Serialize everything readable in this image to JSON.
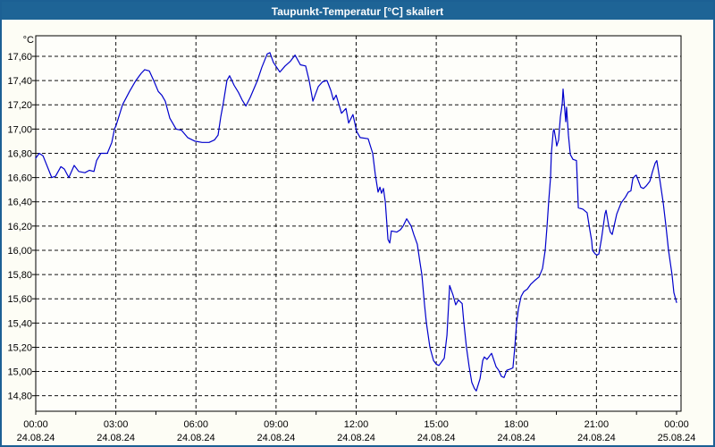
{
  "window": {
    "title": "Taupunkt-Temperatur [°C] skaliert"
  },
  "colors": {
    "titlebar_bg": "#1e6496",
    "window_border": "#1c6094",
    "window_bg": "#fdfdf5",
    "plot_bg": "#fefefa",
    "axis": "#000000",
    "grid": "#111111",
    "line": "#0000cc",
    "title_text": "#ffffff",
    "label_text": "#000000"
  },
  "chart_data": {
    "type": "line",
    "title": "Taupunkt-Temperatur [°C] skaliert",
    "unit_label": "°C",
    "xlabel": "",
    "ylabel": "°C",
    "grid": "dashed",
    "legend": "none",
    "x_range_hours": [
      0,
      24.17
    ],
    "y_range": [
      14.67,
      17.77
    ],
    "y_ticks": [
      {
        "value": 17.6,
        "label": "17,60"
      },
      {
        "value": 17.4,
        "label": "17,40"
      },
      {
        "value": 17.2,
        "label": "17,20"
      },
      {
        "value": 17.0,
        "label": "17,00"
      },
      {
        "value": 16.8,
        "label": "16,80"
      },
      {
        "value": 16.6,
        "label": "16,60"
      },
      {
        "value": 16.4,
        "label": "16,40"
      },
      {
        "value": 16.2,
        "label": "16,20"
      },
      {
        "value": 16.0,
        "label": "16,00"
      },
      {
        "value": 15.8,
        "label": "15,80"
      },
      {
        "value": 15.6,
        "label": "15,60"
      },
      {
        "value": 15.4,
        "label": "15,40"
      },
      {
        "value": 15.2,
        "label": "15,20"
      },
      {
        "value": 15.0,
        "label": "15,00"
      },
      {
        "value": 14.8,
        "label": "14,80"
      }
    ],
    "x_ticks": [
      {
        "hour": 0,
        "time": "00:00",
        "date": "24.08.24",
        "gridline": false
      },
      {
        "hour": 3,
        "time": "03:00",
        "date": "24.08.24",
        "gridline": true
      },
      {
        "hour": 6,
        "time": "06:00",
        "date": "24.08.24",
        "gridline": true
      },
      {
        "hour": 9,
        "time": "09:00",
        "date": "24.08.24",
        "gridline": true
      },
      {
        "hour": 12,
        "time": "12:00",
        "date": "24.08.24",
        "gridline": true
      },
      {
        "hour": 15,
        "time": "15:00",
        "date": "24.08.24",
        "gridline": true
      },
      {
        "hour": 18,
        "time": "18:00",
        "date": "24.08.24",
        "gridline": true
      },
      {
        "hour": 21,
        "time": "21:00",
        "date": "24.08.24",
        "gridline": true
      },
      {
        "hour": 24,
        "time": "00:00",
        "date": "25.08.24",
        "gridline": false
      }
    ],
    "x_minor_ticks_hours": [
      1.5,
      4.5,
      7.5,
      10.5,
      13.5,
      16.5,
      19.5,
      22.5
    ],
    "series": [
      {
        "name": "Taupunkt-Temperatur",
        "color": "#0000cc",
        "points": [
          [
            0,
            16.76
          ],
          [
            0.13,
            16.8
          ],
          [
            0.27,
            16.78
          ],
          [
            0.6,
            16.6
          ],
          [
            0.74,
            16.61
          ],
          [
            0.94,
            16.69
          ],
          [
            1.07,
            16.67
          ],
          [
            1.24,
            16.6
          ],
          [
            1.44,
            16.7
          ],
          [
            1.61,
            16.65
          ],
          [
            1.84,
            16.64
          ],
          [
            2.01,
            16.66
          ],
          [
            2.18,
            16.65
          ],
          [
            2.28,
            16.74
          ],
          [
            2.44,
            16.8
          ],
          [
            2.68,
            16.8
          ],
          [
            2.85,
            16.89
          ],
          [
            2.95,
            17.0
          ],
          [
            3.01,
            17.03
          ],
          [
            3.25,
            17.2
          ],
          [
            3.51,
            17.31
          ],
          [
            3.75,
            17.4
          ],
          [
            3.95,
            17.46
          ],
          [
            4.08,
            17.49
          ],
          [
            4.25,
            17.48
          ],
          [
            4.42,
            17.4
          ],
          [
            4.59,
            17.31
          ],
          [
            4.72,
            17.28
          ],
          [
            4.85,
            17.23
          ],
          [
            5.02,
            17.09
          ],
          [
            5.26,
            17.0
          ],
          [
            5.46,
            16.99
          ],
          [
            5.69,
            16.93
          ],
          [
            5.96,
            16.9
          ],
          [
            6.23,
            16.89
          ],
          [
            6.49,
            16.89
          ],
          [
            6.69,
            16.91
          ],
          [
            6.83,
            16.95
          ],
          [
            6.93,
            17.1
          ],
          [
            7.03,
            17.22
          ],
          [
            7.16,
            17.4
          ],
          [
            7.26,
            17.44
          ],
          [
            7.43,
            17.36
          ],
          [
            7.6,
            17.3
          ],
          [
            7.73,
            17.24
          ],
          [
            7.87,
            17.19
          ],
          [
            8.03,
            17.26
          ],
          [
            8.3,
            17.4
          ],
          [
            8.47,
            17.51
          ],
          [
            8.67,
            17.62
          ],
          [
            8.77,
            17.63
          ],
          [
            8.9,
            17.55
          ],
          [
            9.14,
            17.47
          ],
          [
            9.34,
            17.52
          ],
          [
            9.54,
            17.56
          ],
          [
            9.71,
            17.61
          ],
          [
            9.91,
            17.53
          ],
          [
            10.11,
            17.52
          ],
          [
            10.24,
            17.4
          ],
          [
            10.38,
            17.23
          ],
          [
            10.58,
            17.35
          ],
          [
            10.74,
            17.39
          ],
          [
            10.91,
            17.4
          ],
          [
            11.05,
            17.32
          ],
          [
            11.15,
            17.24
          ],
          [
            11.25,
            17.28
          ],
          [
            11.45,
            17.13
          ],
          [
            11.62,
            17.17
          ],
          [
            11.72,
            17.05
          ],
          [
            11.88,
            17.12
          ],
          [
            12.02,
            16.98
          ],
          [
            12.15,
            16.93
          ],
          [
            12.45,
            16.92
          ],
          [
            12.62,
            16.8
          ],
          [
            12.72,
            16.62
          ],
          [
            12.82,
            16.48
          ],
          [
            12.89,
            16.52
          ],
          [
            12.95,
            16.47
          ],
          [
            13.02,
            16.51
          ],
          [
            13.09,
            16.4
          ],
          [
            13.19,
            16.09
          ],
          [
            13.26,
            16.06
          ],
          [
            13.32,
            16.16
          ],
          [
            13.52,
            16.15
          ],
          [
            13.66,
            16.17
          ],
          [
            13.76,
            16.2
          ],
          [
            13.89,
            16.26
          ],
          [
            14.06,
            16.2
          ],
          [
            14.16,
            16.13
          ],
          [
            14.29,
            16.05
          ],
          [
            14.39,
            15.9
          ],
          [
            14.46,
            15.8
          ],
          [
            14.56,
            15.55
          ],
          [
            14.63,
            15.4
          ],
          [
            14.76,
            15.2
          ],
          [
            14.9,
            15.09
          ],
          [
            15.0,
            15.06
          ],
          [
            15.1,
            15.05
          ],
          [
            15.3,
            15.11
          ],
          [
            15.4,
            15.3
          ],
          [
            15.5,
            15.71
          ],
          [
            15.63,
            15.63
          ],
          [
            15.73,
            15.55
          ],
          [
            15.83,
            15.59
          ],
          [
            15.97,
            15.56
          ],
          [
            16.03,
            15.41
          ],
          [
            16.13,
            15.2
          ],
          [
            16.23,
            15.04
          ],
          [
            16.33,
            14.91
          ],
          [
            16.43,
            14.86
          ],
          [
            16.5,
            14.84
          ],
          [
            16.64,
            14.94
          ],
          [
            16.74,
            15.09
          ],
          [
            16.8,
            15.12
          ],
          [
            16.9,
            15.1
          ],
          [
            17.07,
            15.15
          ],
          [
            17.24,
            15.04
          ],
          [
            17.34,
            15.01
          ],
          [
            17.44,
            14.96
          ],
          [
            17.54,
            14.95
          ],
          [
            17.64,
            15.01
          ],
          [
            17.77,
            15.02
          ],
          [
            17.87,
            15.03
          ],
          [
            17.94,
            15.2
          ],
          [
            18.01,
            15.4
          ],
          [
            18.08,
            15.52
          ],
          [
            18.18,
            15.62
          ],
          [
            18.28,
            15.66
          ],
          [
            18.41,
            15.68
          ],
          [
            18.54,
            15.72
          ],
          [
            18.68,
            15.75
          ],
          [
            18.85,
            15.78
          ],
          [
            18.98,
            15.85
          ],
          [
            19.08,
            16.0
          ],
          [
            19.15,
            16.2
          ],
          [
            19.21,
            16.4
          ],
          [
            19.28,
            16.6
          ],
          [
            19.31,
            16.8
          ],
          [
            19.38,
            16.98
          ],
          [
            19.41,
            17.0
          ],
          [
            19.48,
            16.91
          ],
          [
            19.51,
            16.86
          ],
          [
            19.58,
            16.91
          ],
          [
            19.65,
            17.1
          ],
          [
            19.72,
            17.21
          ],
          [
            19.75,
            17.33
          ],
          [
            19.85,
            17.06
          ],
          [
            19.88,
            17.18
          ],
          [
            19.95,
            16.95
          ],
          [
            20.02,
            16.79
          ],
          [
            20.12,
            16.75
          ],
          [
            20.25,
            16.74
          ],
          [
            20.32,
            16.35
          ],
          [
            20.49,
            16.34
          ],
          [
            20.65,
            16.31
          ],
          [
            20.75,
            16.17
          ],
          [
            20.82,
            16.08
          ],
          [
            20.85,
            16.0
          ],
          [
            20.95,
            15.97
          ],
          [
            21.02,
            15.96
          ],
          [
            21.09,
            15.97
          ],
          [
            21.19,
            16.1
          ],
          [
            21.32,
            16.3
          ],
          [
            21.36,
            16.33
          ],
          [
            21.46,
            16.2
          ],
          [
            21.52,
            16.15
          ],
          [
            21.59,
            16.13
          ],
          [
            21.76,
            16.3
          ],
          [
            21.92,
            16.39
          ],
          [
            22.09,
            16.44
          ],
          [
            22.19,
            16.48
          ],
          [
            22.29,
            16.49
          ],
          [
            22.36,
            16.59
          ],
          [
            22.43,
            16.61
          ],
          [
            22.49,
            16.62
          ],
          [
            22.66,
            16.52
          ],
          [
            22.76,
            16.51
          ],
          [
            22.86,
            16.53
          ],
          [
            23.0,
            16.57
          ],
          [
            23.1,
            16.65
          ],
          [
            23.2,
            16.72
          ],
          [
            23.26,
            16.74
          ],
          [
            23.36,
            16.6
          ],
          [
            23.5,
            16.39
          ],
          [
            23.6,
            16.2
          ],
          [
            23.7,
            16.0
          ],
          [
            23.83,
            15.8
          ],
          [
            23.9,
            15.65
          ],
          [
            24.0,
            15.57
          ]
        ]
      }
    ]
  }
}
